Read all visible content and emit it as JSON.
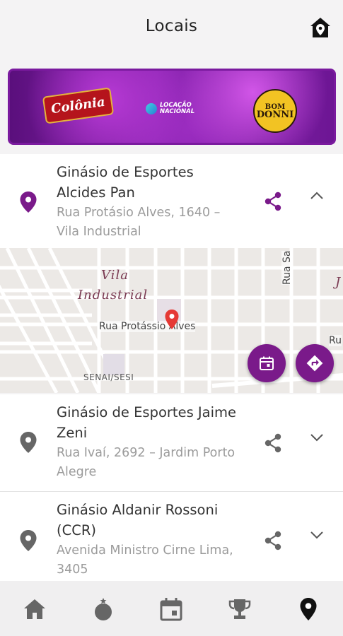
{
  "header": {
    "title": "Locais",
    "right_icon": "home-pin-icon"
  },
  "banner": {
    "sponsors": [
      {
        "name": "Colônia"
      },
      {
        "name_line1": "LOCAÇÃO",
        "name_line2": "NACIONAL"
      },
      {
        "name_line1": "BOM",
        "name_line2": "DONNI"
      }
    ]
  },
  "venues": [
    {
      "name_line1": "Ginásio de Esportes",
      "name_line2": "Alcides Pan",
      "address_line1": "Rua Protásio Alves, 1640 –",
      "address_line2": "Vila Industrial",
      "expanded": true,
      "pin_color": "#7a1a8a"
    },
    {
      "name_line1": "Ginásio de Esportes Jaime",
      "name_line2": "Zeni",
      "address_line1": "Rua Ivaí, 2692 – Jardim Porto",
      "address_line2": "Alegre",
      "expanded": false,
      "pin_color": "#666666"
    },
    {
      "name_line1": "Ginásio Aldanir Rossoni",
      "name_line2": "(CCR)",
      "address_line1": "Avenida Ministro Cirne Lima,",
      "address_line2": "3405",
      "expanded": false,
      "pin_color": "#666666"
    }
  ],
  "map": {
    "district_line1": "Vila",
    "district_line2": "Industrial",
    "street_main": "Rua Protássio Alves",
    "street_vertical": "Rua Sa",
    "poi": "SENAI/SESI",
    "right_edge_letters": "J",
    "right_edge_ru": "Ru",
    "marker_color": "#e53935"
  },
  "bottom_nav": {
    "items": [
      "home-icon",
      "medal-icon",
      "calendar-icon",
      "trophy-icon",
      "location-pin-icon"
    ],
    "active": "location-pin-icon"
  },
  "colors": {
    "accent": "#7a1a8a",
    "icon_gray": "#666666"
  }
}
